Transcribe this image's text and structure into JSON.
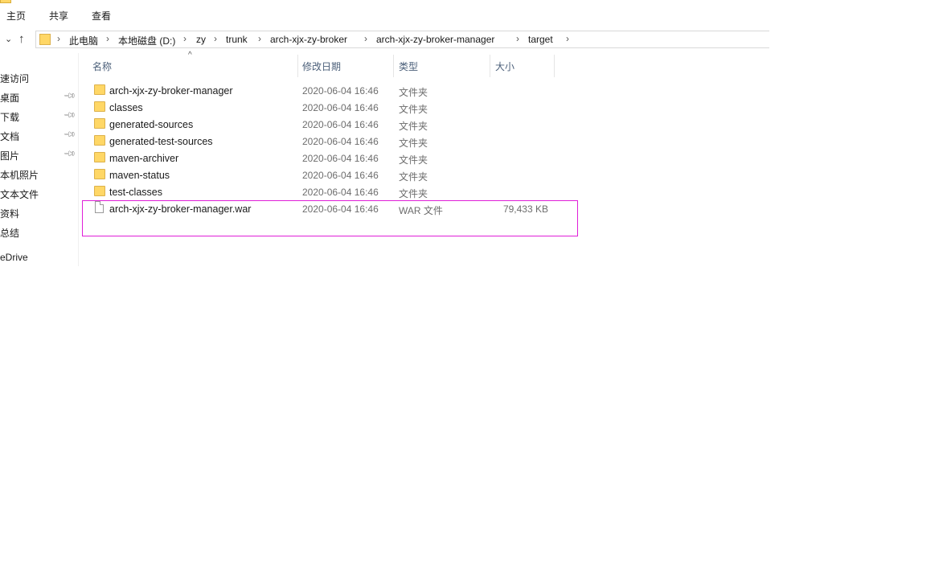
{
  "ribbon": {
    "tabs": [
      {
        "label": "主页"
      },
      {
        "label": "共享"
      },
      {
        "label": "查看"
      }
    ]
  },
  "address_bar": {
    "crumbs": [
      "此电脑",
      "本地磁盘 (D:)",
      "zy",
      "trunk",
      "arch-xjx-zy-broker",
      "arch-xjx-zy-broker-manager",
      "target"
    ],
    "separator": "›"
  },
  "nav_pane": {
    "items": [
      {
        "label": "速访问",
        "pinned": false
      },
      {
        "label": "桌面",
        "pinned": true
      },
      {
        "label": "下载",
        "pinned": true
      },
      {
        "label": "文档",
        "pinned": true
      },
      {
        "label": "图片",
        "pinned": true
      },
      {
        "label": "本机照片",
        "pinned": false
      },
      {
        "label": "文本文件",
        "pinned": false
      },
      {
        "label": "资料",
        "pinned": false
      },
      {
        "label": "总结",
        "pinned": false
      },
      {
        "label": "eDrive",
        "pinned": false
      }
    ]
  },
  "columns": {
    "name": "名称",
    "date": "修改日期",
    "type": "类型",
    "size": "大小"
  },
  "files": [
    {
      "name": "arch-xjx-zy-broker-manager",
      "date": "2020-06-04 16:46",
      "type": "文件夹",
      "size": "",
      "icon": "folder-icon"
    },
    {
      "name": "classes",
      "date": "2020-06-04 16:46",
      "type": "文件夹",
      "size": "",
      "icon": "folder-icon"
    },
    {
      "name": "generated-sources",
      "date": "2020-06-04 16:46",
      "type": "文件夹",
      "size": "",
      "icon": "folder-icon"
    },
    {
      "name": "generated-test-sources",
      "date": "2020-06-04 16:46",
      "type": "文件夹",
      "size": "",
      "icon": "folder-icon"
    },
    {
      "name": "maven-archiver",
      "date": "2020-06-04 16:46",
      "type": "文件夹",
      "size": "",
      "icon": "folder-icon"
    },
    {
      "name": "maven-status",
      "date": "2020-06-04 16:46",
      "type": "文件夹",
      "size": "",
      "icon": "folder-icon"
    },
    {
      "name": "test-classes",
      "date": "2020-06-04 16:46",
      "type": "文件夹",
      "size": "",
      "icon": "folder-icon"
    },
    {
      "name": "arch-xjx-zy-broker-manager.war",
      "date": "2020-06-04 16:46",
      "type": "WAR 文件",
      "size": "79,433 KB",
      "icon": "file-icon"
    }
  ],
  "colors": {
    "folder": "#ffd766",
    "header_text": "#4c607a",
    "highlight_border": "#e01fd8"
  }
}
